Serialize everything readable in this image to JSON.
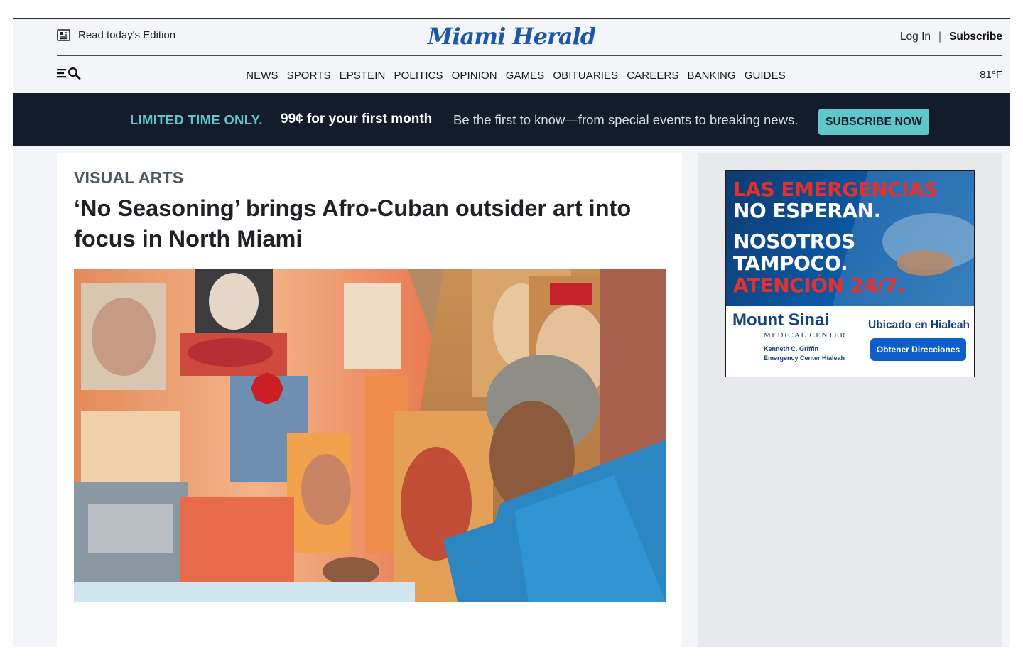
{
  "header": {
    "edition_label": "Read today's Edition",
    "logo_text": "Miami Herald",
    "login_label": "Log In",
    "separator": "|",
    "subscribe_label": "Subscribe"
  },
  "nav": {
    "items": [
      "NEWS",
      "SPORTS",
      "EPSTEIN",
      "POLITICS",
      "OPINION",
      "GAMES",
      "OBITUARIES",
      "CAREERS",
      "BANKING",
      "GUIDES"
    ],
    "temperature": "81°F"
  },
  "promo": {
    "limited": "LIMITED TIME ONLY.",
    "price_prefix": "99¢ for your ",
    "price_bold": "first month",
    "text": "Be the first to know—from special events to breaking news.",
    "button": "SUBSCRIBE NOW",
    "bg_color": "#141b2a",
    "accent_color": "#5fc7c9"
  },
  "article": {
    "category": "VISUAL ARTS",
    "headline": "‘No Seasoning’ brings Afro-Cuban outsider art into focus in North Miami"
  },
  "ad": {
    "line1": "LAS EMERGENCIAS",
    "line2": "NO ESPERAN.",
    "line3": "NOSOTROS",
    "line4": "TAMPOCO.",
    "line5": "ATENCIÓN 24/7.",
    "brand": "Mount Sinai",
    "brand_sub": "MEDICAL CENTER",
    "small_text": "Kenneth C. Griffin Emergency Center Hialeah",
    "location": "Ubicado en Hialeah",
    "button": "Obtener Direcciones"
  }
}
